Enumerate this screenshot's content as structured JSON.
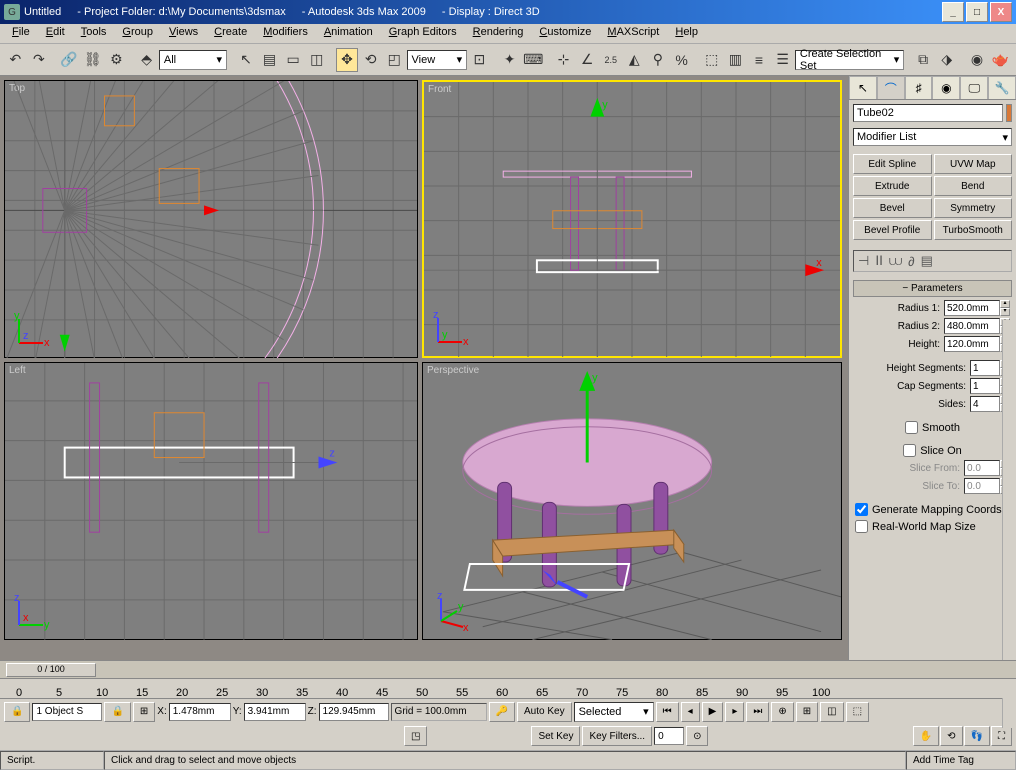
{
  "titlebar": {
    "doc": "Untitled",
    "folder": "- Project Folder: d:\\My Documents\\3dsmax",
    "app": "- Autodesk 3ds Max  2009",
    "display": "- Display : Direct 3D"
  },
  "menu": [
    "File",
    "Edit",
    "Tools",
    "Group",
    "Views",
    "Create",
    "Modifiers",
    "Animation",
    "Graph Editors",
    "Rendering",
    "Customize",
    "MAXScript",
    "Help"
  ],
  "toolbar": {
    "layer_combo": "All",
    "view_combo": "View",
    "selset_combo": "Create Selection Set"
  },
  "viewports": {
    "top": "Top",
    "front": "Front",
    "left": "Left",
    "persp": "Perspective"
  },
  "panel": {
    "object_name": "Tube02",
    "modifier_list": "Modifier List",
    "buttons": [
      "Edit Spline",
      "UVW Map",
      "Extrude",
      "Bend",
      "Bevel",
      "Symmetry",
      "Bevel Profile",
      "TurboSmooth"
    ],
    "rollout": "Parameters",
    "params": {
      "radius1": {
        "label": "Radius 1:",
        "value": "520.0mm"
      },
      "radius2": {
        "label": "Radius 2:",
        "value": "480.0mm"
      },
      "height": {
        "label": "Height:",
        "value": "120.0mm"
      },
      "heightseg": {
        "label": "Height Segments:",
        "value": "1"
      },
      "capseg": {
        "label": "Cap Segments:",
        "value": "1"
      },
      "sides": {
        "label": "Sides:",
        "value": "4"
      }
    },
    "checks": {
      "smooth": "Smooth",
      "sliceon": "Slice On",
      "slicefrom": {
        "label": "Slice From:",
        "value": "0.0"
      },
      "sliceto": {
        "label": "Slice To:",
        "value": "0.0"
      },
      "genmap": "Generate Mapping Coords.",
      "realworld": "Real-World Map Size"
    }
  },
  "time": {
    "slider": "0 / 100",
    "ticks": [
      "0",
      "5",
      "10",
      "15",
      "20",
      "25",
      "30",
      "35",
      "40",
      "45",
      "50",
      "55",
      "60",
      "65",
      "70",
      "75",
      "80",
      "85",
      "90",
      "95",
      "100"
    ]
  },
  "status": {
    "objsel": "1 Object S",
    "x": "1.478mm",
    "y": "3.941mm",
    "z": "129.945mm",
    "grid": "Grid = 100.0mm",
    "autokey": "Auto Key",
    "setkey": "Set Key",
    "keymode": "Selected",
    "keyfilters": "Key Filters..."
  },
  "prompt": {
    "script": "Script.",
    "msg": "Click and drag to select and move objects",
    "addtag": "Add Time Tag"
  }
}
